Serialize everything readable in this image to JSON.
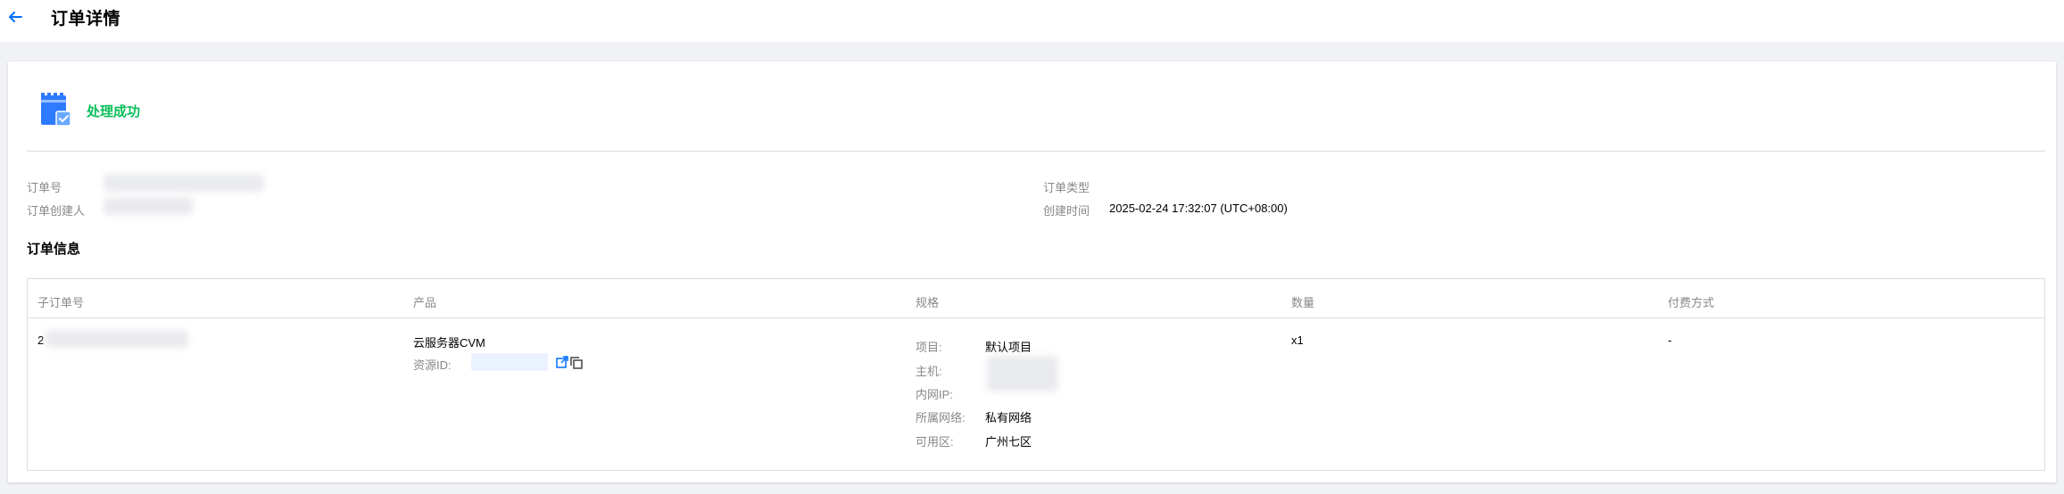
{
  "header": {
    "title": "订单详情",
    "back_icon": "arrow-left-icon",
    "back_color": "#006eff"
  },
  "status": {
    "text": "处理成功",
    "color": "#0abf5b",
    "icon": "order-success-icon"
  },
  "summary": {
    "order_no_label": "订单号",
    "creator_label": "订单创建人",
    "type_label": "订单类型",
    "created_time_label": "创建时间",
    "created_time_value": "2025-02-24 17:32:07 (UTC+08:00)"
  },
  "order_info": {
    "section_title": "订单信息",
    "columns": [
      "子订单号",
      "产品",
      "规格",
      "数量",
      "付费方式"
    ],
    "row": {
      "sub_order_prefix": "2",
      "product_name": "云服务器CVM",
      "resource_id_label": "资源ID:",
      "spec": [
        {
          "label": "项目:",
          "value": "默认项目"
        },
        {
          "label": "主机:",
          "value": ""
        },
        {
          "label": "内网IP:",
          "value": ""
        },
        {
          "label": "所属网络:",
          "value": "私有网络"
        },
        {
          "label": "可用区:",
          "value": "广州七区"
        }
      ],
      "quantity": "x1",
      "payment": "-"
    }
  }
}
